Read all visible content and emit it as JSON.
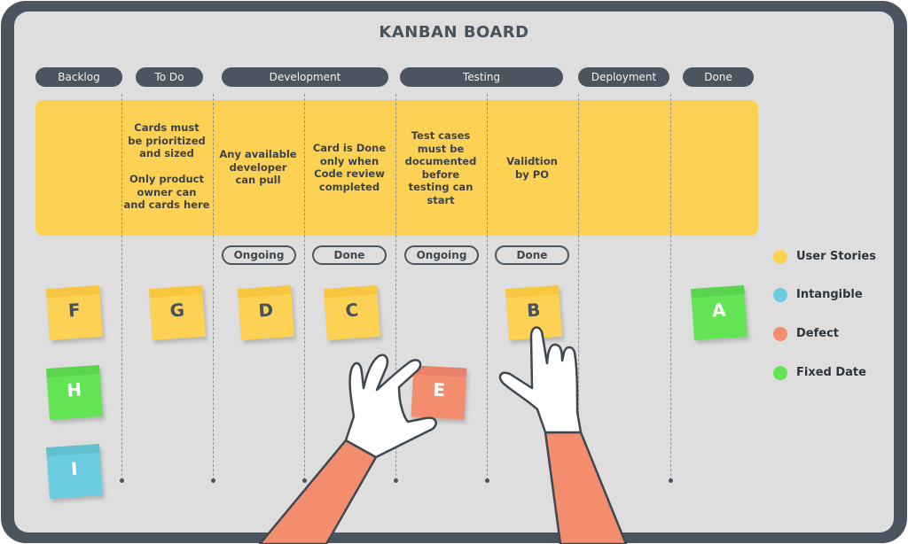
{
  "title": "KANBAN BOARD",
  "columns": [
    {
      "label": "Backlog"
    },
    {
      "label": "To Do"
    },
    {
      "label": "Development"
    },
    {
      "label": "Testing"
    },
    {
      "label": "Deployment"
    },
    {
      "label": "Done"
    }
  ],
  "policies": {
    "todo": "Cards must\nbe prioritized\nand sized\n\nOnly product\nowner can\nand cards here",
    "dev_ongoing": "Any available\ndeveloper\ncan pull",
    "dev_done": "Card is Done\nonly when\nCode review\ncompleted",
    "test_ongoing": "Test cases\nmust be\ndocumented\nbefore\ntesting can\nstart",
    "test_done": "Validtion\nby PO"
  },
  "subcolumns": {
    "dev_ongoing": "Ongoing",
    "dev_done": "Done",
    "test_ongoing": "Ongoing",
    "test_done": "Done"
  },
  "cards": [
    {
      "letter": "F",
      "type": "User Stories",
      "column": "Backlog"
    },
    {
      "letter": "H",
      "type": "Fixed Date",
      "column": "Backlog"
    },
    {
      "letter": "I",
      "type": "Intangible",
      "column": "Backlog"
    },
    {
      "letter": "G",
      "type": "User Stories",
      "column": "To Do"
    },
    {
      "letter": "D",
      "type": "User Stories",
      "column": "Development - Ongoing"
    },
    {
      "letter": "C",
      "type": "User Stories",
      "column": "Development - Done"
    },
    {
      "letter": "E",
      "type": "Defect",
      "column": "held in hand"
    },
    {
      "letter": "B",
      "type": "User Stories",
      "column": "Testing - Done"
    },
    {
      "letter": "A",
      "type": "Fixed Date",
      "column": "Done"
    }
  ],
  "legend": [
    {
      "label": "User Stories",
      "color": "#fdd154"
    },
    {
      "label": "Intangible",
      "color": "#6ccde0"
    },
    {
      "label": "Defect",
      "color": "#f48d6e"
    },
    {
      "label": "Fixed Date",
      "color": "#62e455"
    }
  ],
  "colors": {
    "frame": "#4a5560",
    "board": "#dedede",
    "policy_band": "#fdd154",
    "sleeve": "#f48d6e",
    "glove": "#ffffff"
  }
}
